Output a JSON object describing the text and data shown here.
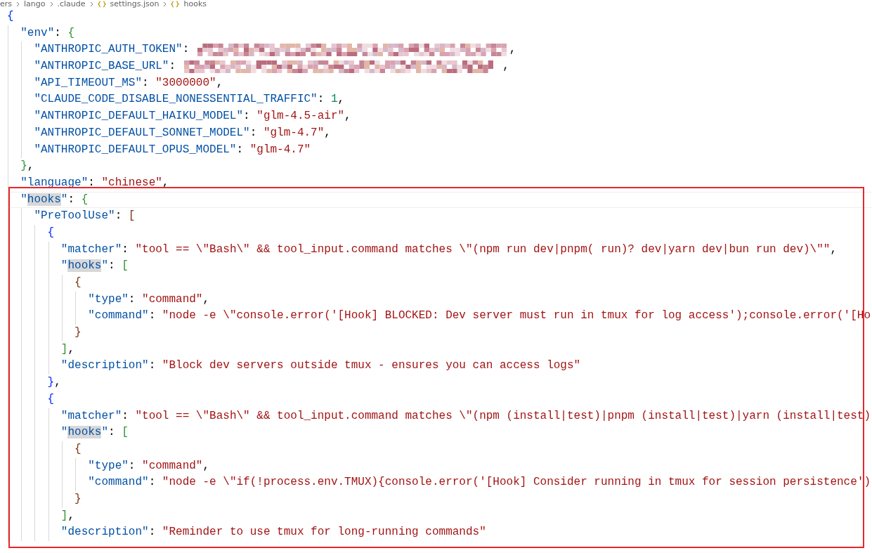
{
  "breadcrumb": [
    {
      "kind": "folder",
      "text": "ers"
    },
    {
      "kind": "folder",
      "text": "lango"
    },
    {
      "kind": "folder",
      "text": ".claude"
    },
    {
      "kind": "json",
      "text": "settings.json"
    },
    {
      "kind": "json",
      "text": "hooks"
    }
  ],
  "lines": [
    {
      "current": false,
      "tokens": [
        {
          "kind": "bracket",
          "text": "{",
          "color": "#0431fa"
        }
      ]
    },
    {
      "current": false,
      "tokens": [
        {
          "kind": "key",
          "text": "  \"env\"",
          "highlighted": false
        },
        {
          "kind": "punct",
          "text": ": "
        },
        {
          "kind": "bracket",
          "text": "{",
          "color": "#319331"
        }
      ]
    },
    {
      "current": false,
      "tokens": [
        {
          "kind": "key",
          "text": "    \"ANTHROPIC_AUTH_TOKEN\"",
          "highlighted": false
        },
        {
          "kind": "punct",
          "text": ": "
        },
        {
          "kind": "redacted"
        },
        {
          "kind": "punct",
          "text": ","
        }
      ]
    },
    {
      "current": false,
      "tokens": [
        {
          "kind": "key",
          "text": "    \"ANTHROPIC_BASE_URL\"",
          "highlighted": false
        },
        {
          "kind": "punct",
          "text": ": "
        },
        {
          "kind": "redacted"
        },
        {
          "kind": "punct",
          "text": " ,"
        }
      ]
    },
    {
      "current": false,
      "tokens": [
        {
          "kind": "key",
          "text": "    \"API_TIMEOUT_MS\"",
          "highlighted": false
        },
        {
          "kind": "punct",
          "text": ": "
        },
        {
          "kind": "string",
          "text": "\"3000000\""
        },
        {
          "kind": "punct",
          "text": ","
        }
      ]
    },
    {
      "current": false,
      "tokens": [
        {
          "kind": "key",
          "text": "    \"CLAUDE_CODE_DISABLE_NONESSENTIAL_TRAFFIC\"",
          "highlighted": false
        },
        {
          "kind": "punct",
          "text": ": "
        },
        {
          "kind": "number",
          "text": "1"
        },
        {
          "kind": "punct",
          "text": ","
        }
      ]
    },
    {
      "current": false,
      "tokens": [
        {
          "kind": "key",
          "text": "    \"ANTHROPIC_DEFAULT_HAIKU_MODEL\"",
          "highlighted": false
        },
        {
          "kind": "punct",
          "text": ": "
        },
        {
          "kind": "string",
          "text": "\"glm-4.5-air\""
        },
        {
          "kind": "punct",
          "text": ","
        }
      ]
    },
    {
      "current": false,
      "tokens": [
        {
          "kind": "key",
          "text": "    \"ANTHROPIC_DEFAULT_SONNET_MODEL\"",
          "highlighted": false
        },
        {
          "kind": "punct",
          "text": ": "
        },
        {
          "kind": "string",
          "text": "\"glm-4.7\""
        },
        {
          "kind": "punct",
          "text": ","
        }
      ]
    },
    {
      "current": false,
      "tokens": [
        {
          "kind": "key",
          "text": "    \"ANTHROPIC_DEFAULT_OPUS_MODEL\"",
          "highlighted": false
        },
        {
          "kind": "punct",
          "text": ": "
        },
        {
          "kind": "string",
          "text": "\"glm-4.7\""
        }
      ]
    },
    {
      "current": false,
      "tokens": [
        {
          "kind": "bracket",
          "text": "  }",
          "color": "#319331"
        },
        {
          "kind": "punct",
          "text": ","
        }
      ]
    },
    {
      "current": false,
      "tokens": [
        {
          "kind": "key",
          "text": "  \"language\"",
          "highlighted": false
        },
        {
          "kind": "punct",
          "text": ": "
        },
        {
          "kind": "string",
          "text": "\"chinese\""
        },
        {
          "kind": "punct",
          "text": ","
        }
      ]
    },
    {
      "current": true,
      "tokens": [
        {
          "kind": "key",
          "text": "  \"hooks\"",
          "highlighted": true
        },
        {
          "kind": "punct",
          "text": ": "
        },
        {
          "kind": "bracket",
          "text": "{",
          "color": "#319331"
        }
      ]
    },
    {
      "current": false,
      "tokens": [
        {
          "kind": "key",
          "text": "    \"PreToolUse\"",
          "highlighted": false
        },
        {
          "kind": "punct",
          "text": ": "
        },
        {
          "kind": "bracket",
          "text": "[",
          "color": "#7b3814"
        }
      ]
    },
    {
      "current": false,
      "tokens": [
        {
          "kind": "bracket",
          "text": "      {",
          "color": "#0431fa"
        }
      ]
    },
    {
      "current": false,
      "tokens": [
        {
          "kind": "key",
          "text": "        \"matcher\"",
          "highlighted": false
        },
        {
          "kind": "punct",
          "text": ": "
        },
        {
          "kind": "string",
          "text": "\"tool == \\\"Bash\\\" && tool_input.command matches \\\"(npm run dev|pnpm( run)? dev|yarn dev|bun run dev)\\\"\""
        },
        {
          "kind": "punct",
          "text": ","
        }
      ]
    },
    {
      "current": false,
      "tokens": [
        {
          "kind": "key",
          "text": "        \"hooks\"",
          "highlighted": true
        },
        {
          "kind": "punct",
          "text": ": "
        },
        {
          "kind": "bracket",
          "text": "[",
          "color": "#319331"
        }
      ]
    },
    {
      "current": false,
      "tokens": [
        {
          "kind": "bracket",
          "text": "          {",
          "color": "#7b3814"
        }
      ]
    },
    {
      "current": false,
      "tokens": [
        {
          "kind": "key",
          "text": "            \"type\"",
          "highlighted": false
        },
        {
          "kind": "punct",
          "text": ": "
        },
        {
          "kind": "string",
          "text": "\"command\""
        },
        {
          "kind": "punct",
          "text": ","
        }
      ]
    },
    {
      "current": false,
      "tokens": [
        {
          "kind": "key",
          "text": "            \"command\"",
          "highlighted": false
        },
        {
          "kind": "punct",
          "text": ": "
        },
        {
          "kind": "string",
          "text": "\"node -e \\\"console.error('[Hook] BLOCKED: Dev server must run in tmux for log access');console.error('[Ho"
        }
      ]
    },
    {
      "current": false,
      "tokens": [
        {
          "kind": "bracket",
          "text": "          }",
          "color": "#7b3814"
        }
      ]
    },
    {
      "current": false,
      "tokens": [
        {
          "kind": "bracket",
          "text": "        ]",
          "color": "#319331"
        },
        {
          "kind": "punct",
          "text": ","
        }
      ]
    },
    {
      "current": false,
      "tokens": [
        {
          "kind": "key",
          "text": "        \"description\"",
          "highlighted": false
        },
        {
          "kind": "punct",
          "text": ": "
        },
        {
          "kind": "string",
          "text": "\"Block dev servers outside tmux - ensures you can access logs\""
        }
      ]
    },
    {
      "current": false,
      "tokens": [
        {
          "kind": "bracket",
          "text": "      }",
          "color": "#0431fa"
        },
        {
          "kind": "punct",
          "text": ","
        }
      ]
    },
    {
      "current": false,
      "tokens": [
        {
          "kind": "bracket",
          "text": "      {",
          "color": "#0431fa"
        }
      ]
    },
    {
      "current": false,
      "tokens": [
        {
          "kind": "key",
          "text": "        \"matcher\"",
          "highlighted": false
        },
        {
          "kind": "punct",
          "text": ": "
        },
        {
          "kind": "string",
          "text": "\"tool == \\\"Bash\\\" && tool_input.command matches \\\"(npm (install|test)|pnpm (install|test)|yarn (install|test)"
        }
      ]
    },
    {
      "current": false,
      "tokens": [
        {
          "kind": "key",
          "text": "        \"hooks\"",
          "highlighted": true
        },
        {
          "kind": "punct",
          "text": ": "
        },
        {
          "kind": "bracket",
          "text": "[",
          "color": "#319331"
        }
      ]
    },
    {
      "current": false,
      "tokens": [
        {
          "kind": "bracket",
          "text": "          {",
          "color": "#7b3814"
        }
      ]
    },
    {
      "current": false,
      "tokens": [
        {
          "kind": "key",
          "text": "            \"type\"",
          "highlighted": false
        },
        {
          "kind": "punct",
          "text": ": "
        },
        {
          "kind": "string",
          "text": "\"command\""
        },
        {
          "kind": "punct",
          "text": ","
        }
      ]
    },
    {
      "current": false,
      "tokens": [
        {
          "kind": "key",
          "text": "            \"command\"",
          "highlighted": false
        },
        {
          "kind": "punct",
          "text": ": "
        },
        {
          "kind": "string",
          "text": "\"node -e \\\"if(!process.env.TMUX){console.error('[Hook] Consider running in tmux for session persistence')"
        }
      ]
    },
    {
      "current": false,
      "tokens": [
        {
          "kind": "bracket",
          "text": "          }",
          "color": "#7b3814"
        }
      ]
    },
    {
      "current": false,
      "tokens": [
        {
          "kind": "bracket",
          "text": "        ]",
          "color": "#319331"
        },
        {
          "kind": "punct",
          "text": ","
        }
      ]
    },
    {
      "current": false,
      "tokens": [
        {
          "kind": "key",
          "text": "        \"description\"",
          "highlighted": false
        },
        {
          "kind": "punct",
          "text": ": "
        },
        {
          "kind": "string",
          "text": "\"Reminder to use tmux for long-running commands\""
        }
      ]
    }
  ]
}
